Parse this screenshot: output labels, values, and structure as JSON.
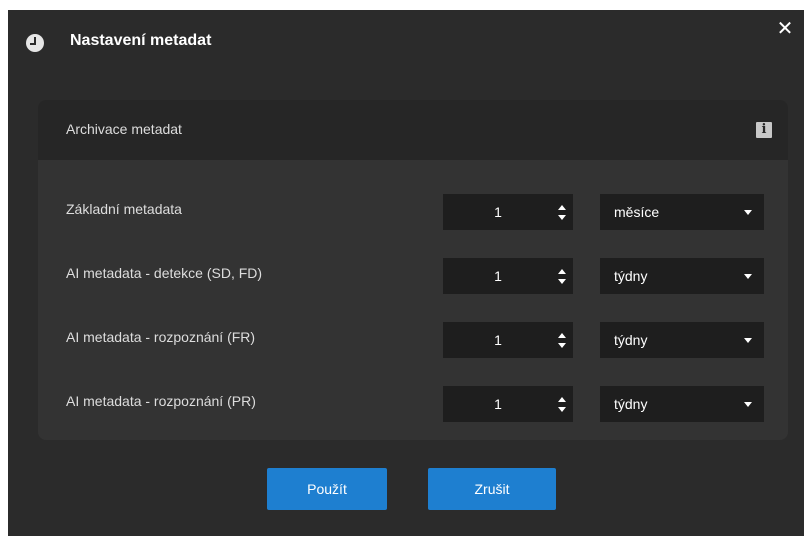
{
  "dialog": {
    "title": "Nastavení metadat",
    "close_label": "✕",
    "title_icon": "clock-icon"
  },
  "panel": {
    "title": "Archivace metadat",
    "info_icon": "i",
    "rows": [
      {
        "label": "Základní metadata",
        "value": "1",
        "unit": "měsíce"
      },
      {
        "label": "AI metadata - detekce (SD, FD)",
        "value": "1",
        "unit": "týdny"
      },
      {
        "label": "AI metadata - rozpoznání (FR)",
        "value": "1",
        "unit": "týdny"
      },
      {
        "label": "AI metadata - rozpoznání (PR)",
        "value": "1",
        "unit": "týdny"
      }
    ]
  },
  "buttons": {
    "apply": "Použít",
    "cancel": "Zrušit"
  },
  "colors": {
    "dialog_bg": "#2b2b2b",
    "panel_bg": "#333333",
    "header_bg": "#262626",
    "field_bg": "#1e1e1e",
    "accent": "#1e7fd0"
  }
}
